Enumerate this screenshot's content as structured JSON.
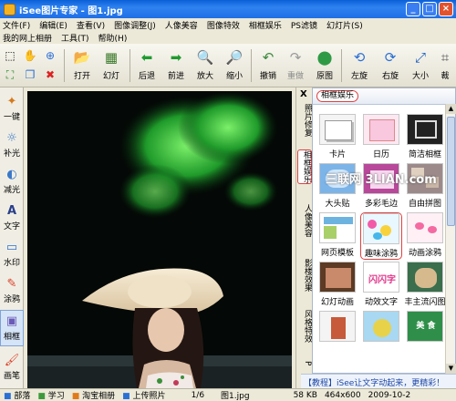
{
  "window": {
    "title": "iSee图片专家 - 图1.jpg",
    "min": "_",
    "max": "□",
    "close": "×"
  },
  "menu": {
    "row1": [
      "文件(F)",
      "编辑(E)",
      "查看(V)",
      "图像调整(J)",
      "人像美容",
      "图像特效",
      "相框娱乐",
      "PS滤镜",
      "幻灯片(S)"
    ],
    "row2": [
      "我的网上相册",
      "工具(T)",
      "帮助(H)"
    ]
  },
  "toolbar": {
    "buttons": [
      {
        "label": "打开",
        "icon": "open-folder-icon"
      },
      {
        "label": "幻灯",
        "icon": "slideshow-icon"
      },
      {
        "label": "后退",
        "icon": "back-arrow-icon"
      },
      {
        "label": "前进",
        "icon": "forward-arrow-icon"
      },
      {
        "label": "放大",
        "icon": "zoom-in-icon"
      },
      {
        "label": "缩小",
        "icon": "zoom-out-icon"
      },
      {
        "label": "撤销",
        "icon": "undo-icon"
      },
      {
        "label": "重做",
        "icon": "redo-icon"
      },
      {
        "label": "原图",
        "icon": "original-icon"
      },
      {
        "label": "左旋",
        "icon": "rotate-left-icon"
      },
      {
        "label": "右旋",
        "icon": "rotate-right-icon"
      },
      {
        "label": "大小",
        "icon": "resize-icon"
      },
      {
        "label": "裁",
        "icon": "crop-icon"
      }
    ]
  },
  "left_tools": [
    {
      "label": "一键",
      "icon": "magic-wand-icon"
    },
    {
      "label": "补光",
      "icon": "fill-light-icon"
    },
    {
      "label": "减光",
      "icon": "reduce-light-icon"
    },
    {
      "label": "文字",
      "icon": "text-icon"
    },
    {
      "label": "水印",
      "icon": "watermark-icon"
    },
    {
      "label": "涂鸦",
      "icon": "doodle-icon"
    },
    {
      "label": "相框",
      "icon": "frame-icon"
    },
    {
      "label": "画笔",
      "icon": "brush-icon"
    }
  ],
  "side_tabs": [
    "照片修复",
    "相框娱乐",
    "人像美容",
    "影楼效果",
    "风格特效",
    "P"
  ],
  "side_close": "X",
  "panel": {
    "title": "相框娱乐",
    "items": [
      "卡片",
      "日历",
      "简洁相框",
      "大头贴",
      "多彩毛边",
      "自由拼图",
      "网页模板",
      "趣味涂鸦",
      "动画涂鸦",
      "幻灯动画",
      "动效文字",
      "丰主流闪图",
      "",
      "",
      ""
    ]
  },
  "watermark": "三联网 3LIAN.com",
  "ad": "【教程】iSee让文字动起来，更精彩！",
  "statusbar": [
    "部落",
    "学习",
    "淘宝相册",
    "上传照片",
    "1/6",
    "图1.jpg",
    "58 KB",
    "464x600",
    "2009-10-2"
  ]
}
